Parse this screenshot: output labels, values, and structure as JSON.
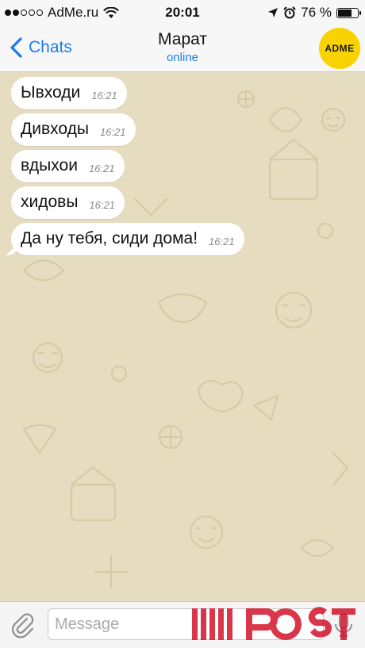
{
  "status_bar": {
    "carrier": "AdMe.ru",
    "time": "20:01",
    "battery_percent": "76 %",
    "battery_level": 0.76
  },
  "nav": {
    "back_label": "Chats",
    "contact_name": "Марат",
    "contact_status": "online",
    "avatar_text": "ADME"
  },
  "messages": [
    {
      "text": "Ывходи",
      "time": "16:21"
    },
    {
      "text": "Дивходы",
      "time": "16:21"
    },
    {
      "text": "вдыхои",
      "time": "16:21"
    },
    {
      "text": "хидовы",
      "time": "16:21"
    },
    {
      "text": "Да ну тебя, сиди дома!",
      "time": "16:21"
    }
  ],
  "input": {
    "placeholder": "Message"
  },
  "colors": {
    "accent": "#1a7cf0",
    "wallpaper": "#e6dcc0",
    "avatar_bg": "#f9d300",
    "watermark": "#d3132a"
  },
  "icons": [
    "wifi-icon",
    "location-arrow-icon",
    "alarm-icon",
    "battery-icon",
    "chevron-left-icon",
    "paperclip-icon",
    "microphone-icon"
  ]
}
